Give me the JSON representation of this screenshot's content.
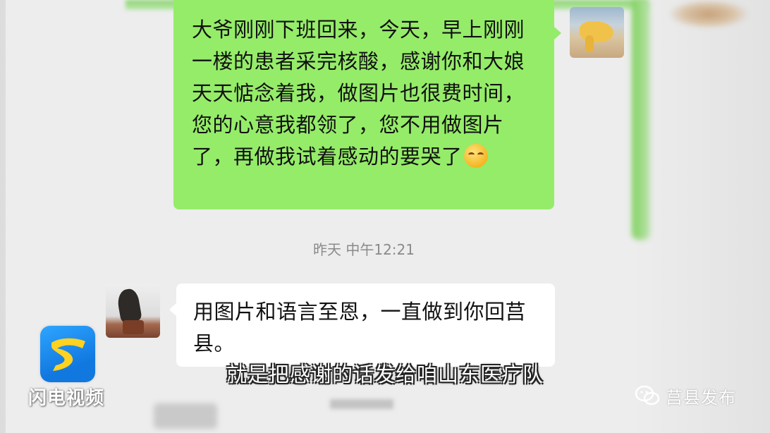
{
  "chat": {
    "outgoing_message": "大爷刚刚下班回来，今天，早上刚刚一楼的患者采完核酸，感谢你和大娘天天惦念着我，做图片也很费时间，您的心意我都领了，您不用做图片了，再做我试着感动的要哭了",
    "outgoing_emoji": "crying-laughing-emoji",
    "timestamp": "昨天 中午12:21",
    "incoming_message": "用图片和语言至恩，一直做到你回莒县。"
  },
  "overlay": {
    "channel_logo_text": "闪电视频",
    "subtitle": "就是把感谢的话发给咱山东医疗队",
    "watermark": "莒县发布"
  },
  "colors": {
    "outgoing_bubble": "#95ec69",
    "incoming_bubble": "#ffffff",
    "chat_background": "#ededed",
    "logo_blue": "#1178e0",
    "logo_yellow": "#ffd21f"
  }
}
